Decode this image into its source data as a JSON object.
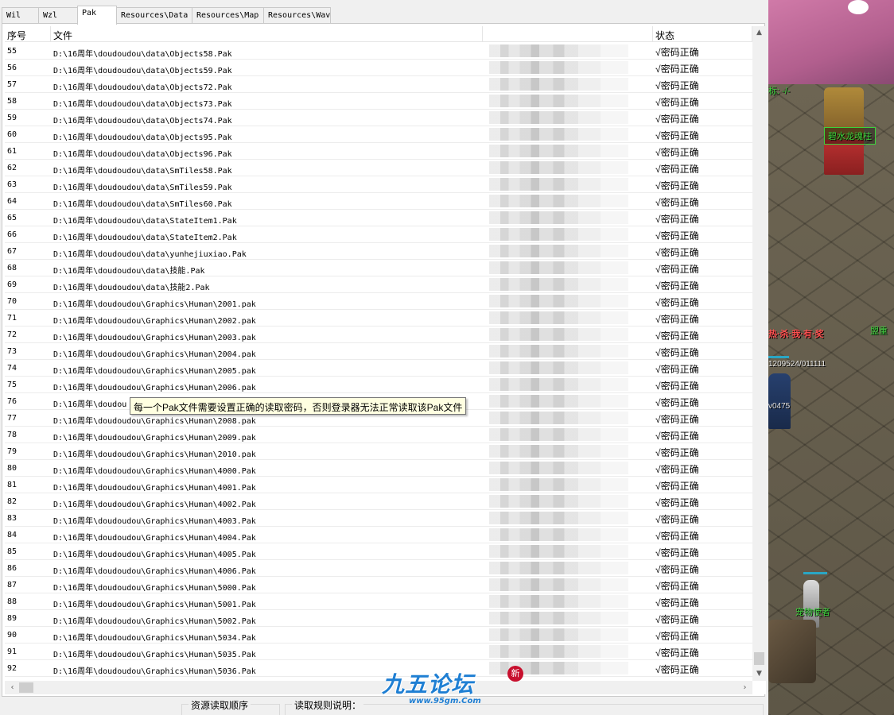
{
  "tabs": [
    "Wil",
    "Wzl",
    "Pak",
    "Resources\\Data",
    "Resources\\Map",
    "Resources\\Wav"
  ],
  "active_tab": "Pak",
  "columns": {
    "seq": "序号",
    "file": "文件",
    "password": "",
    "status": "状态"
  },
  "status_ok": "√密码正确",
  "rows": [
    {
      "seq": "55",
      "file": "D:\\16周年\\doudoudou\\data\\Objects58.Pak"
    },
    {
      "seq": "56",
      "file": "D:\\16周年\\doudoudou\\data\\Objects59.Pak"
    },
    {
      "seq": "57",
      "file": "D:\\16周年\\doudoudou\\data\\Objects72.Pak"
    },
    {
      "seq": "58",
      "file": "D:\\16周年\\doudoudou\\data\\Objects73.Pak"
    },
    {
      "seq": "59",
      "file": "D:\\16周年\\doudoudou\\data\\Objects74.Pak"
    },
    {
      "seq": "60",
      "file": "D:\\16周年\\doudoudou\\data\\Objects95.Pak"
    },
    {
      "seq": "61",
      "file": "D:\\16周年\\doudoudou\\data\\Objects96.Pak"
    },
    {
      "seq": "62",
      "file": "D:\\16周年\\doudoudou\\data\\SmTiles58.Pak"
    },
    {
      "seq": "63",
      "file": "D:\\16周年\\doudoudou\\data\\SmTiles59.Pak"
    },
    {
      "seq": "64",
      "file": "D:\\16周年\\doudoudou\\data\\SmTiles60.Pak"
    },
    {
      "seq": "65",
      "file": "D:\\16周年\\doudoudou\\data\\StateItem1.Pak"
    },
    {
      "seq": "66",
      "file": "D:\\16周年\\doudoudou\\data\\StateItem2.Pak"
    },
    {
      "seq": "67",
      "file": "D:\\16周年\\doudoudou\\data\\yunhejiuxiao.Pak"
    },
    {
      "seq": "68",
      "file": "D:\\16周年\\doudoudou\\data\\技能.Pak"
    },
    {
      "seq": "69",
      "file": "D:\\16周年\\doudoudou\\data\\技能2.Pak"
    },
    {
      "seq": "70",
      "file": "D:\\16周年\\doudoudou\\Graphics\\Human\\2001.pak"
    },
    {
      "seq": "71",
      "file": "D:\\16周年\\doudoudou\\Graphics\\Human\\2002.pak"
    },
    {
      "seq": "72",
      "file": "D:\\16周年\\doudoudou\\Graphics\\Human\\2003.pak"
    },
    {
      "seq": "73",
      "file": "D:\\16周年\\doudoudou\\Graphics\\Human\\2004.pak"
    },
    {
      "seq": "74",
      "file": "D:\\16周年\\doudoudou\\Graphics\\Human\\2005.pak"
    },
    {
      "seq": "75",
      "file": "D:\\16周年\\doudoudou\\Graphics\\Human\\2006.pak"
    },
    {
      "seq": "76",
      "file": "D:\\16周年\\doudou"
    },
    {
      "seq": "77",
      "file": "D:\\16周年\\doudoudou\\Graphics\\Human\\2008.pak"
    },
    {
      "seq": "78",
      "file": "D:\\16周年\\doudoudou\\Graphics\\Human\\2009.pak"
    },
    {
      "seq": "79",
      "file": "D:\\16周年\\doudoudou\\Graphics\\Human\\2010.pak"
    },
    {
      "seq": "80",
      "file": "D:\\16周年\\doudoudou\\Graphics\\Human\\4000.Pak"
    },
    {
      "seq": "81",
      "file": "D:\\16周年\\doudoudou\\Graphics\\Human\\4001.Pak"
    },
    {
      "seq": "82",
      "file": "D:\\16周年\\doudoudou\\Graphics\\Human\\4002.Pak"
    },
    {
      "seq": "83",
      "file": "D:\\16周年\\doudoudou\\Graphics\\Human\\4003.Pak"
    },
    {
      "seq": "84",
      "file": "D:\\16周年\\doudoudou\\Graphics\\Human\\4004.Pak"
    },
    {
      "seq": "85",
      "file": "D:\\16周年\\doudoudou\\Graphics\\Human\\4005.Pak"
    },
    {
      "seq": "86",
      "file": "D:\\16周年\\doudoudou\\Graphics\\Human\\4006.Pak"
    },
    {
      "seq": "87",
      "file": "D:\\16周年\\doudoudou\\Graphics\\Human\\5000.Pak"
    },
    {
      "seq": "88",
      "file": "D:\\16周年\\doudoudou\\Graphics\\Human\\5001.Pak"
    },
    {
      "seq": "89",
      "file": "D:\\16周年\\doudoudou\\Graphics\\Human\\5002.Pak"
    },
    {
      "seq": "90",
      "file": "D:\\16周年\\doudoudou\\Graphics\\Human\\5034.Pak"
    },
    {
      "seq": "91",
      "file": "D:\\16周年\\doudoudou\\Graphics\\Human\\5035.Pak"
    },
    {
      "seq": "92",
      "file": "D:\\16周年\\doudoudou\\Graphics\\Human\\5036.Pak"
    }
  ],
  "tooltip": "每一个Pak文件需要设置正确的读取密码，否则登录器无法正常读取该Pak文件",
  "bottom": {
    "group1_label": "资源读取顺序",
    "group2_label": "读取规则说明："
  },
  "watermark": {
    "brand": "九五论坛",
    "url": "www.95gm.Com",
    "badge": "新"
  },
  "game": {
    "coord_label": "标: -/-",
    "pillar_label": "碧水龙魂柱",
    "red_banner": "热·杀·我·有·奖",
    "stats_text": "1209524/011111",
    "level_text": "v0475",
    "side_label": "盟重",
    "pet_label": "宠物使者"
  },
  "colors": {
    "accent": "#1f7fd3",
    "tooltip_bg": "#ffffe1",
    "game_green": "#3bd23b"
  }
}
